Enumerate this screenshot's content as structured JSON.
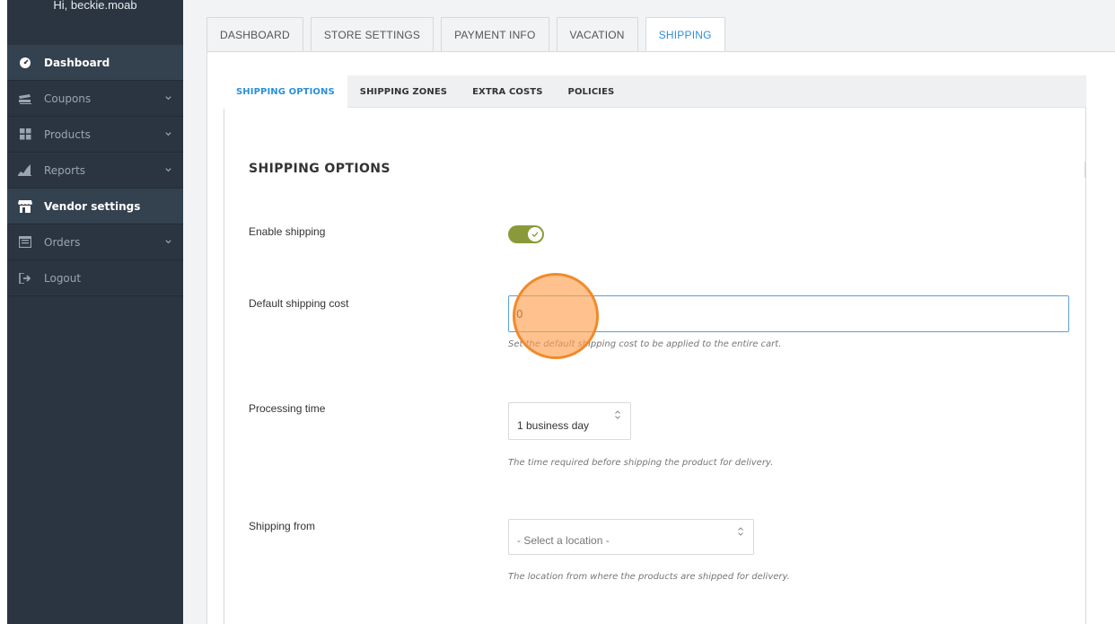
{
  "sidebar": {
    "greeting": "Hi, beckie.moab",
    "items": [
      {
        "label": "Dashboard",
        "icon": "dashboard-icon",
        "active": true,
        "chevron": false
      },
      {
        "label": "Coupons",
        "icon": "coupons-icon",
        "active": false,
        "chevron": true
      },
      {
        "label": "Products",
        "icon": "products-icon",
        "active": false,
        "chevron": true
      },
      {
        "label": "Reports",
        "icon": "reports-icon",
        "active": false,
        "chevron": true
      },
      {
        "label": "Vendor settings",
        "icon": "store-icon",
        "active": true,
        "chevron": false
      },
      {
        "label": "Orders",
        "icon": "orders-icon",
        "active": false,
        "chevron": true
      },
      {
        "label": "Logout",
        "icon": "logout-icon",
        "active": false,
        "chevron": false
      }
    ]
  },
  "top_tabs": {
    "dashboard": "DASHBOARD",
    "store_settings": "STORE SETTINGS",
    "payment_info": "PAYMENT INFO",
    "vacation": "VACATION",
    "shipping": "SHIPPING",
    "active": "SHIPPING"
  },
  "sub_tabs": {
    "shipping_options": "SHIPPING OPTIONS",
    "shipping_zones": "SHIPPING ZONES",
    "extra_costs": "EXTRA COSTS",
    "policies": "POLICIES",
    "active": "SHIPPING OPTIONS"
  },
  "section": {
    "title": "SHIPPING OPTIONS"
  },
  "form": {
    "enable_shipping": {
      "label": "Enable shipping",
      "enabled": true
    },
    "default_shipping_cost": {
      "label": "Default shipping cost",
      "value": "0",
      "help": "Set the default shipping cost to be applied to the entire cart."
    },
    "processing_time": {
      "label": "Processing time",
      "value": "1 business day",
      "help": "The time required before shipping the product for delivery."
    },
    "shipping_from": {
      "label": "Shipping from",
      "placeholder": "- Select a location -",
      "help": "The location from where the products are shipped for delivery."
    }
  },
  "colors": {
    "sidebar_bg": "#2a3541",
    "accent": "#2b90d9",
    "toggle_on": "#8a9a3a",
    "click_indicator": "#f08a2a"
  }
}
